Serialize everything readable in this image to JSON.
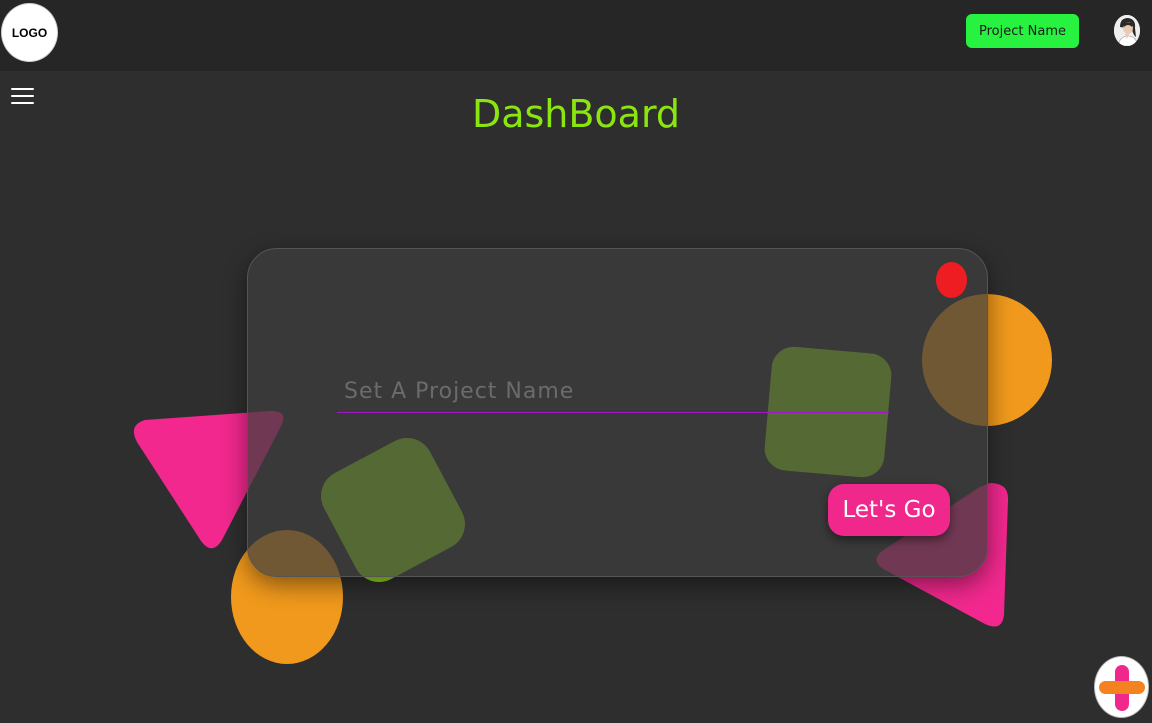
{
  "header": {
    "logo_text": "LOGO",
    "project_button_label": "Project Name",
    "avatar_icon": "user-avatar"
  },
  "sidebar": {
    "menu_icon": "hamburger-menu-icon"
  },
  "main": {
    "title": "DashBoard",
    "card": {
      "input_placeholder": "Set A Project Name",
      "input_value": "",
      "submit_label": "Let's Go",
      "close_icon": "red-dot-close-icon"
    }
  },
  "fab": {
    "icon": "plus-icon"
  },
  "colors": {
    "background": "#2e2e2e",
    "topbar": "#262626",
    "title_green": "#8be60f",
    "project_button_green": "#27f23f",
    "accent_pink": "#f0288c",
    "accent_orange": "#f0991c",
    "input_underline": "#a019c8",
    "close_red": "#ee1d22"
  }
}
